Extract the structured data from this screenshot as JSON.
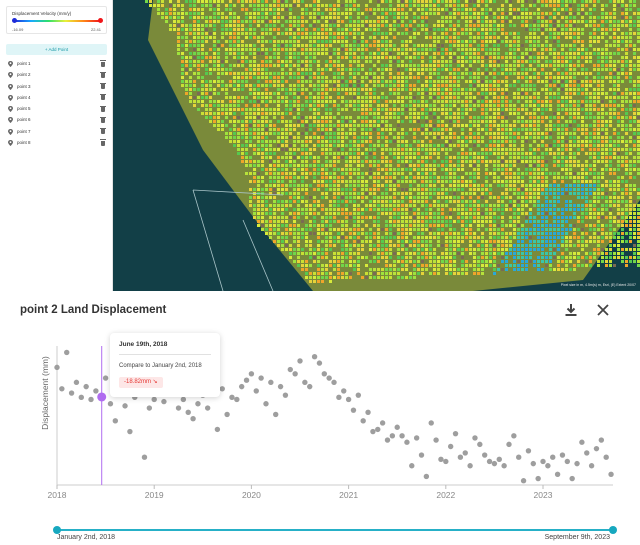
{
  "legend": {
    "title": "Displacement Velocity (mm/y)",
    "min": "-16.09",
    "max": "22.41",
    "min_color": "#1e2bd8",
    "max_color": "#f0161a"
  },
  "sidebar": {
    "add_point_label": "+ Add Point",
    "points": [
      "point 1",
      "point 2",
      "point 3",
      "point 4",
      "point 5",
      "point 6",
      "point 7",
      "point 8"
    ]
  },
  "map": {
    "attribution": "Pixel size in m, 4.5m(s) m, Esri, (E) Extent 20/07"
  },
  "panel": {
    "title": "point 2 Land Displacement",
    "download_icon": "download-icon",
    "close_icon": "close-icon"
  },
  "tooltip": {
    "date": "June 19th, 2018",
    "compare": "Compare to January 2nd, 2018",
    "value": "-18.82mm ↘"
  },
  "range": {
    "start": "January 2nd, 2018",
    "end": "September 9th, 2023"
  },
  "colors": {
    "accent": "#26b0c7",
    "point": "#9e9e9e",
    "highlight": "#b06cf0",
    "negative": "#e53935"
  },
  "chart_data": {
    "type": "scatter",
    "xlabel": "",
    "ylabel": "Displacement (mm)",
    "x_ticks": [
      "2018",
      "2019",
      "2020",
      "2021",
      "2022",
      "2023"
    ],
    "xlim": [
      2018.0,
      2023.72
    ],
    "ylim": [
      -60,
      5
    ],
    "highlight": {
      "x": 2018.46,
      "y": -18.82
    },
    "x": [
      2018.0,
      2018.05,
      2018.1,
      2018.15,
      2018.2,
      2018.25,
      2018.3,
      2018.35,
      2018.4,
      2018.46,
      2018.5,
      2018.55,
      2018.6,
      2018.65,
      2018.7,
      2018.75,
      2018.8,
      2018.85,
      2018.9,
      2018.95,
      2019.0,
      2019.05,
      2019.1,
      2019.15,
      2019.2,
      2019.25,
      2019.3,
      2019.35,
      2019.4,
      2019.45,
      2019.5,
      2019.55,
      2019.6,
      2019.65,
      2019.7,
      2019.75,
      2019.8,
      2019.85,
      2019.9,
      2019.95,
      2020.0,
      2020.05,
      2020.1,
      2020.15,
      2020.2,
      2020.25,
      2020.3,
      2020.35,
      2020.4,
      2020.45,
      2020.5,
      2020.55,
      2020.6,
      2020.65,
      2020.7,
      2020.75,
      2020.8,
      2020.85,
      2020.9,
      2020.95,
      2021.0,
      2021.05,
      2021.1,
      2021.15,
      2021.2,
      2021.25,
      2021.3,
      2021.35,
      2021.4,
      2021.45,
      2021.5,
      2021.55,
      2021.6,
      2021.65,
      2021.7,
      2021.75,
      2021.8,
      2021.85,
      2021.9,
      2021.95,
      2022.0,
      2022.05,
      2022.1,
      2022.15,
      2022.2,
      2022.25,
      2022.3,
      2022.35,
      2022.4,
      2022.45,
      2022.5,
      2022.55,
      2022.6,
      2022.65,
      2022.7,
      2022.75,
      2022.8,
      2022.85,
      2022.9,
      2022.95,
      2023.0,
      2023.05,
      2023.1,
      2023.15,
      2023.2,
      2023.25,
      2023.3,
      2023.35,
      2023.4,
      2023.45,
      2023.5,
      2023.55,
      2023.6,
      2023.65,
      2023.7
    ],
    "y": [
      -5,
      -15,
      2,
      -17,
      -12,
      -19,
      -14,
      -20,
      -16,
      -18.8,
      -10,
      -22,
      -30,
      -17,
      -23,
      -35,
      -19,
      -13,
      -47,
      -24,
      -20,
      -16,
      -21,
      -14,
      -15,
      -24,
      -20,
      -26,
      -29,
      -22,
      -18,
      -24,
      -13,
      -34,
      -15,
      -27,
      -19,
      -20,
      -14,
      -11,
      -8,
      -16,
      -10,
      -22,
      -12,
      -27,
      -14,
      -18,
      -6,
      -8,
      -2,
      -12,
      -14,
      0,
      -3,
      -8,
      -10,
      -12,
      -19,
      -16,
      -20,
      -25,
      -18,
      -30,
      -26,
      -35,
      -34,
      -31,
      -39,
      -37,
      -33,
      -37,
      -40,
      -51,
      -38,
      -46,
      -56,
      -31,
      -39,
      -48,
      -49,
      -42,
      -36,
      -47,
      -45,
      -51,
      -38,
      -41,
      -46,
      -49,
      -50,
      -48,
      -51,
      -41,
      -37,
      -47,
      -58,
      -44,
      -50,
      -57,
      -49,
      -51,
      -47,
      -55,
      -46,
      -49,
      -57,
      -50,
      -40,
      -45,
      -51,
      -43,
      -39,
      -47,
      -55
    ]
  }
}
